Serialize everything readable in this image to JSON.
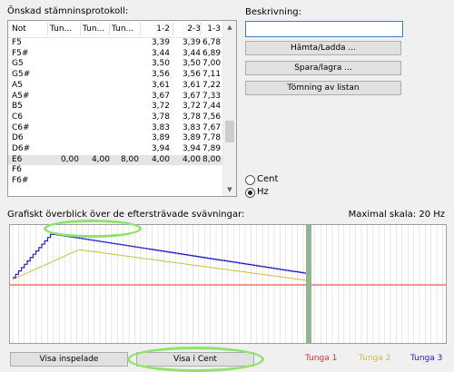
{
  "protocol": {
    "title": "Önskad stämninsprotokoll:",
    "columns": [
      "Not",
      "Tun...",
      "Tun...",
      "Tun...",
      "1-2",
      "2-3",
      "1-3"
    ],
    "rows": [
      [
        "F5",
        "",
        "",
        "",
        "3,39",
        "3,39",
        "6,78"
      ],
      [
        "F5#",
        "",
        "",
        "",
        "3,44",
        "3,44",
        "6,89"
      ],
      [
        "G5",
        "",
        "",
        "",
        "3,50",
        "3,50",
        "7,00"
      ],
      [
        "G5#",
        "",
        "",
        "",
        "3,56",
        "3,56",
        "7,11"
      ],
      [
        "A5",
        "",
        "",
        "",
        "3,61",
        "3,61",
        "7,22"
      ],
      [
        "A5#",
        "",
        "",
        "",
        "3,67",
        "3,67",
        "7,33"
      ],
      [
        "B5",
        "",
        "",
        "",
        "3,72",
        "3,72",
        "7,44"
      ],
      [
        "C6",
        "",
        "",
        "",
        "3,78",
        "3,78",
        "7,56"
      ],
      [
        "C6#",
        "",
        "",
        "",
        "3,83",
        "3,83",
        "7,67"
      ],
      [
        "D6",
        "",
        "",
        "",
        "3,89",
        "3,89",
        "7,78"
      ],
      [
        "D6#",
        "",
        "",
        "",
        "3,94",
        "3,94",
        "7,89"
      ],
      [
        "E6",
        "0,00",
        "4,00",
        "8,00",
        "4,00",
        "4,00",
        "8,00"
      ],
      [
        "F6",
        "",
        "",
        "",
        "",
        "",
        ""
      ],
      [
        "F6#",
        "",
        "",
        "",
        "",
        "",
        ""
      ]
    ],
    "selected_row": 11
  },
  "description": {
    "label": "Beskrivning:",
    "value": ""
  },
  "buttons": {
    "fetch": "Hämta/Ladda ...",
    "save": "Spara/lagra ...",
    "clear": "Tömning av listan",
    "show_recorded": "Visa inspelade",
    "show_cent": "Visa i Cent"
  },
  "units": {
    "cent_label": "Cent",
    "hz_label": "Hz",
    "selected": "Hz"
  },
  "graph": {
    "title": "Grafiskt överblick över de eftersträvade svävningar:",
    "scale_label": "Maximal skala: 20 Hz"
  },
  "legend": {
    "tunga1": "Tunga 1",
    "tunga2": "Tunga 2",
    "tunga3": "Tunga 3"
  },
  "colors": {
    "tunga1": "#e03030",
    "tunga2": "#c8c040",
    "tunga3": "#2020c8",
    "highlight": "#8ee36a",
    "marker": "#90b890"
  }
}
